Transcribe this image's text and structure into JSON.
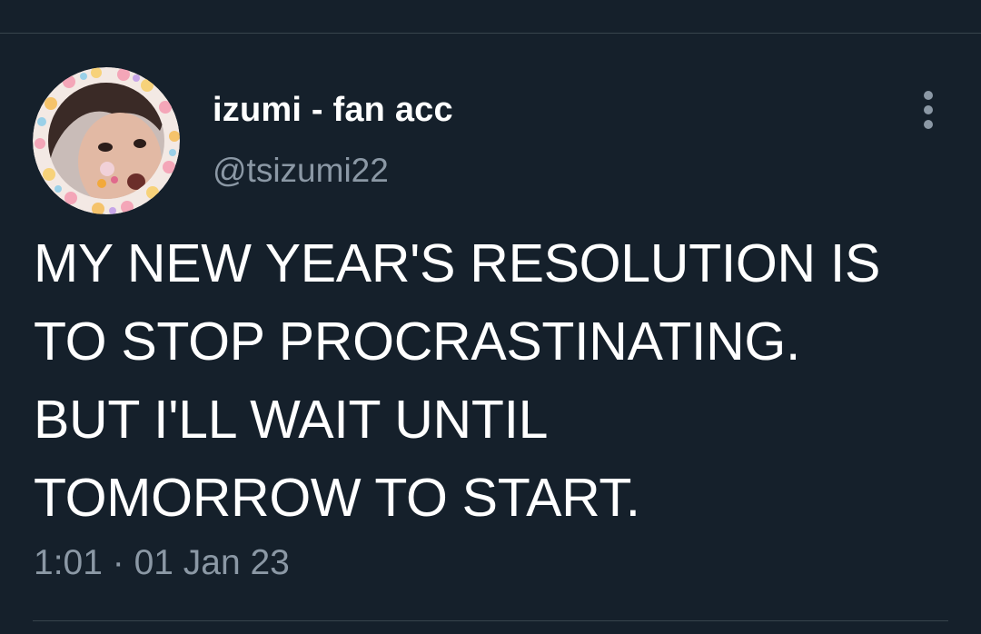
{
  "tweet": {
    "author": {
      "display_name": "izumi - fan acc",
      "handle": "@tsizumi22",
      "avatar_icon": "profile-photo-with-sticker-frame"
    },
    "text": "MY NEW YEAR'S RESOLUTION IS\nTO STOP PROCRASTINATING.\nBUT I'LL WAIT UNTIL\nTOMORROW TO START.",
    "timestamp": "1:01 · 01 Jan 23",
    "more_icon": "vertical-ellipsis-icon"
  },
  "colors": {
    "background": "#15202b",
    "divider": "#38444d",
    "text_primary": "#ffffff",
    "text_secondary": "#8b98a5"
  }
}
